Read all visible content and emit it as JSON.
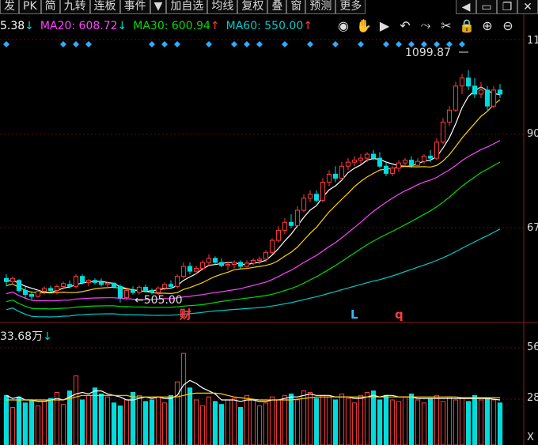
{
  "toolbar": {
    "buttons": [
      "发",
      "PK",
      "简",
      "九转",
      "连板",
      "事件",
      "▼",
      "加自选",
      "均线",
      "复权",
      "叠",
      "窗",
      "预测",
      "更多"
    ],
    "icons": [
      "chevron-left",
      "expand",
      "restore",
      "close"
    ]
  },
  "ma_bar": {
    "ma10": {
      "label": "5.38",
      "arrow": "↓",
      "color": "#ffffff"
    },
    "ma20": {
      "label": "MA20: 608.72",
      "arrow": "↓",
      "color": "#ff44ff"
    },
    "ma30": {
      "label": "MA30: 600.94",
      "arrow": "↑",
      "color": "#00dd00"
    },
    "ma60": {
      "label": "MA60: 550.00",
      "arrow": "↑",
      "color": "#00cccc"
    }
  },
  "annotations": {
    "high_label": "1099.87",
    "low_label": "505.00",
    "event_cai": "财",
    "event_l": "L",
    "event_q": "q"
  },
  "price_axis": [
    "11",
    "90",
    "67"
  ],
  "volume": {
    "label": "33.68万",
    "arrow": "↓",
    "axis": [
      "56",
      "28",
      "X"
    ]
  },
  "colors": {
    "up": "#ff3d3d",
    "down": "#00dcdc",
    "ma5": "#ffffff",
    "ma10": "#ffd200",
    "ma20": "#ff44ff",
    "ma30": "#00dd00",
    "ma60": "#00cccc",
    "marker": "#33aaff"
  },
  "chart_data": {
    "type": "candlestick",
    "price_range": [
      470,
      1180
    ],
    "candles": [
      [
        580,
        590,
        560,
        572
      ],
      [
        572,
        585,
        565,
        580
      ],
      [
        575,
        578,
        545,
        550
      ],
      [
        550,
        560,
        530,
        540
      ],
      [
        540,
        548,
        528,
        535
      ],
      [
        535,
        552,
        532,
        548
      ],
      [
        548,
        560,
        540,
        555
      ],
      [
        555,
        562,
        545,
        550
      ],
      [
        550,
        565,
        540,
        560
      ],
      [
        560,
        572,
        552,
        567
      ],
      [
        565,
        575,
        555,
        560
      ],
      [
        560,
        590,
        555,
        585
      ],
      [
        585,
        590,
        565,
        570
      ],
      [
        570,
        578,
        560,
        575
      ],
      [
        575,
        580,
        565,
        570
      ],
      [
        570,
        580,
        560,
        565
      ],
      [
        565,
        572,
        555,
        568
      ],
      [
        568,
        570,
        555,
        560
      ],
      [
        560,
        565,
        520,
        532
      ],
      [
        532,
        555,
        525,
        550
      ],
      [
        550,
        560,
        540,
        545
      ],
      [
        545,
        562,
        540,
        558
      ],
      [
        558,
        565,
        545,
        550
      ],
      [
        550,
        555,
        540,
        545
      ],
      [
        545,
        560,
        538,
        556
      ],
      [
        556,
        570,
        550,
        565
      ],
      [
        565,
        575,
        555,
        560
      ],
      [
        560,
        590,
        555,
        585
      ],
      [
        585,
        620,
        580,
        610
      ],
      [
        610,
        620,
        590,
        598
      ],
      [
        598,
        612,
        590,
        605
      ],
      [
        605,
        625,
        600,
        620
      ],
      [
        620,
        640,
        610,
        630
      ],
      [
        630,
        635,
        615,
        620
      ],
      [
        620,
        630,
        608,
        612
      ],
      [
        612,
        620,
        600,
        615
      ],
      [
        615,
        625,
        605,
        620
      ],
      [
        620,
        625,
        605,
        610
      ],
      [
        610,
        625,
        605,
        618
      ],
      [
        618,
        630,
        612,
        625
      ],
      [
        625,
        635,
        615,
        628
      ],
      [
        628,
        650,
        620,
        645
      ],
      [
        645,
        680,
        640,
        675
      ],
      [
        675,
        710,
        670,
        700
      ],
      [
        700,
        730,
        690,
        720
      ],
      [
        720,
        740,
        705,
        712
      ],
      [
        712,
        760,
        708,
        750
      ],
      [
        750,
        790,
        745,
        780
      ],
      [
        780,
        800,
        770,
        790
      ],
      [
        790,
        800,
        770,
        775
      ],
      [
        775,
        830,
        770,
        820
      ],
      [
        820,
        850,
        810,
        840
      ],
      [
        840,
        860,
        820,
        830
      ],
      [
        830,
        870,
        825,
        860
      ],
      [
        860,
        880,
        850,
        870
      ],
      [
        870,
        885,
        860,
        875
      ],
      [
        875,
        890,
        865,
        880
      ],
      [
        880,
        895,
        870,
        890
      ],
      [
        890,
        900,
        875,
        880
      ],
      [
        880,
        895,
        855,
        860
      ],
      [
        860,
        870,
        835,
        842
      ],
      [
        842,
        860,
        835,
        855
      ],
      [
        855,
        875,
        845,
        868
      ],
      [
        868,
        880,
        860,
        875
      ],
      [
        875,
        885,
        855,
        862
      ],
      [
        862,
        880,
        858,
        872
      ],
      [
        872,
        890,
        865,
        885
      ],
      [
        885,
        900,
        870,
        880
      ],
      [
        880,
        930,
        875,
        920
      ],
      [
        920,
        980,
        915,
        970
      ],
      [
        970,
        1010,
        960,
        1000
      ],
      [
        1000,
        1070,
        995,
        1060
      ],
      [
        1060,
        1090,
        1040,
        1080
      ],
      [
        1080,
        1099.87,
        1050,
        1060
      ],
      [
        1060,
        1080,
        1030,
        1040
      ],
      [
        1040,
        1070,
        1030,
        1050
      ],
      [
        1050,
        1060,
        1000,
        1010
      ],
      [
        1010,
        1060,
        1005,
        1050
      ],
      [
        1050,
        1065,
        1030,
        1040
      ]
    ],
    "volume_range": [
      0,
      700000
    ],
    "volumes": [
      330000,
      250000,
      320000,
      280000,
      300000,
      260000,
      290000,
      310000,
      350000,
      270000,
      360000,
      460000,
      300000,
      330000,
      380000,
      340000,
      320000,
      280000,
      260000,
      300000,
      350000,
      330000,
      290000,
      300000,
      320000,
      280000,
      330000,
      420000,
      610000,
      380000,
      300000,
      260000,
      320000,
      290000,
      270000,
      300000,
      310000,
      250000,
      330000,
      300000,
      260000,
      280000,
      320000,
      300000,
      330000,
      340000,
      300000,
      360000,
      350000,
      310000,
      330000,
      320000,
      300000,
      340000,
      310000,
      280000,
      330000,
      350000,
      360000,
      300000,
      330000,
      300000,
      290000,
      320000,
      340000,
      300000,
      280000,
      310000,
      330000,
      290000,
      320000,
      300000,
      310000,
      290000,
      330000,
      300000,
      310000,
      300000,
      280000
    ],
    "ma5_volume": [
      330000,
      310000,
      320000,
      300000,
      300000,
      290000,
      290000,
      300000,
      310000,
      300000,
      320000,
      340000,
      350000,
      340000,
      360000,
      360000,
      340000,
      330000,
      320000,
      300000,
      300000,
      310000,
      320000,
      310000,
      320000,
      310000,
      310000,
      330000,
      400000,
      430000,
      410000,
      380000,
      360000,
      340000,
      300000,
      300000,
      300000,
      290000,
      300000,
      300000,
      290000,
      290000,
      300000,
      300000,
      310000,
      320000,
      320000,
      330000,
      340000,
      330000,
      330000,
      330000,
      320000,
      320000,
      320000,
      310000,
      310000,
      320000,
      330000,
      320000,
      330000,
      330000,
      320000,
      320000,
      320000,
      310000,
      310000,
      310000,
      310000,
      310000,
      310000,
      310000,
      310000,
      310000,
      310000,
      310000,
      310000,
      305000,
      300000
    ],
    "ma10_volume": [
      300000,
      300000,
      300000,
      300000,
      300000,
      300000,
      300000,
      300000,
      300000,
      300000,
      310000,
      320000,
      330000,
      330000,
      330000,
      330000,
      330000,
      330000,
      330000,
      330000,
      320000,
      320000,
      320000,
      320000,
      320000,
      320000,
      320000,
      320000,
      330000,
      340000,
      345000,
      345000,
      345000,
      345000,
      340000,
      330000,
      320000,
      315000,
      310000,
      305000,
      300000,
      300000,
      300000,
      300000,
      300000,
      300000,
      305000,
      310000,
      315000,
      320000,
      320000,
      320000,
      320000,
      320000,
      320000,
      320000,
      320000,
      320000,
      320000,
      320000,
      320000,
      320000,
      320000,
      320000,
      320000,
      320000,
      320000,
      320000,
      320000,
      320000,
      320000,
      320000,
      315000,
      315000,
      315000,
      315000,
      315000,
      315000,
      315000
    ]
  }
}
